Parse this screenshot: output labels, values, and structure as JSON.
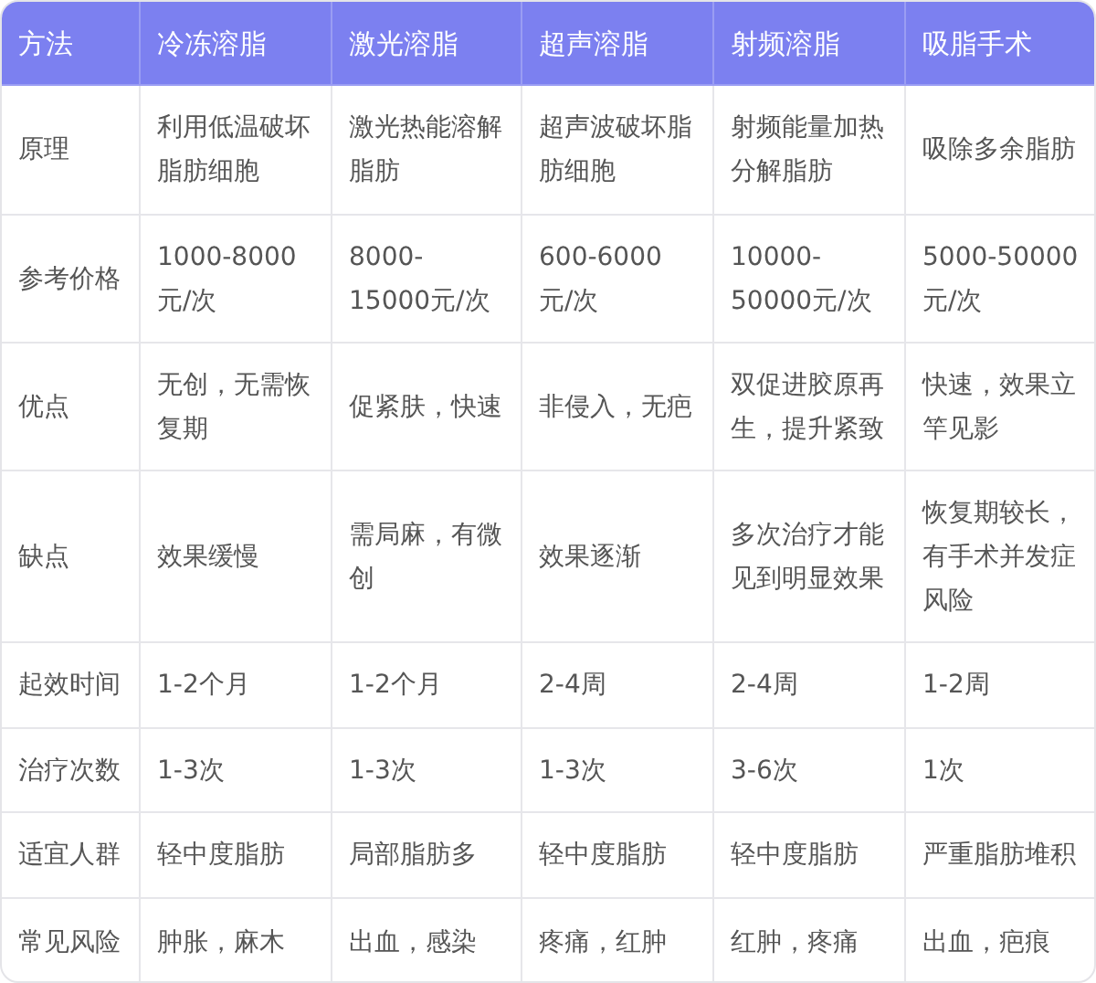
{
  "table": {
    "columns": [
      "方法",
      "冷冻溶脂",
      "激光溶脂",
      "超声溶脂",
      "射频溶脂",
      "吸脂手术"
    ],
    "rows": [
      [
        "原理",
        "利用低温破坏脂肪细胞",
        "激光热能溶解脂肪",
        "超声波破坏脂肪细胞",
        "射频能量加热分解脂肪",
        "吸除多余脂肪"
      ],
      [
        "参考价格",
        "1000-8000元/次",
        "8000-15000元/次",
        "600-6000元/次",
        "10000-50000元/次",
        "5000-50000元/次"
      ],
      [
        "优点",
        "无创，无需恢复期",
        "促紧肤，快速",
        "非侵入，无疤",
        "双促进胶原再生，提升紧致",
        "快速，效果立竿见影"
      ],
      [
        "缺点",
        "效果缓慢",
        "需局麻，有微创",
        "效果逐渐",
        "多次治疗才能见到明显效果",
        "恢复期较长，有手术并发症风险"
      ],
      [
        "起效时间",
        "1-2个月",
        "1-2个月",
        "2-4周",
        "2-4周",
        "1-2周"
      ],
      [
        "治疗次数",
        "1-3次",
        "1-3次",
        "1-3次",
        "3-6次",
        "1次"
      ],
      [
        "适宜人群",
        "轻中度脂肪",
        "局部脂肪多",
        "轻中度脂肪",
        "轻中度脂肪",
        "严重脂肪堆积"
      ],
      [
        "常见风险",
        "肿胀，麻木",
        "出血，感染",
        "疼痛，红肿",
        "红肿，疼痛",
        "出血，疤痕"
      ]
    ]
  }
}
